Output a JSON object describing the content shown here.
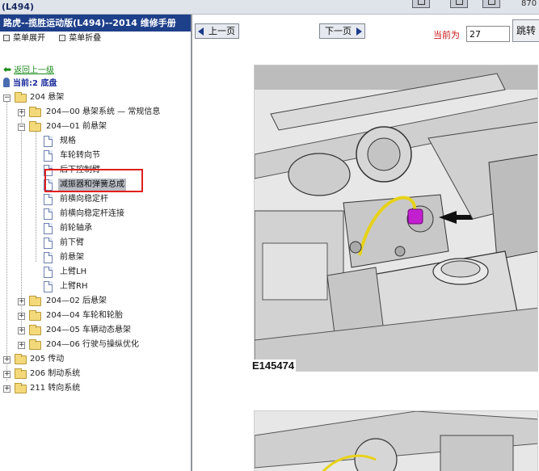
{
  "window": {
    "title": "(L494)",
    "corner_text": "870"
  },
  "sidebar": {
    "doc_title": "路虎--揽胜运动版(L494)--2014 维修手册",
    "menu_expand": "菜单展开",
    "menu_collapse": "菜单折叠",
    "back_link": "返回上一级",
    "current": "当前:2 底盘",
    "tree": {
      "n204": "204 悬架",
      "n204_00": "204—00 悬架系统 — 常规信息",
      "n204_01": "204—01 前悬架",
      "leaf_1": "规格",
      "leaf_2": "车轮转向节",
      "leaf_3": "后下控制臂",
      "leaf_4": "减振器和弹簧总成",
      "leaf_5": "前横向稳定杆",
      "leaf_6": "前横向稳定杆连接",
      "leaf_7": "前轮轴承",
      "leaf_8": "前下臂",
      "leaf_9": "前悬架",
      "leaf_10": "上臂LH",
      "leaf_11": "上臂RH",
      "n204_02": "204—02 后悬架",
      "n204_04": "204—04 车轮和轮胎",
      "n204_05": "204—05 车辆动态悬架",
      "n204_06": "204—06 行驶与操纵优化",
      "n205": "205 传动",
      "n206": "206 制动系统",
      "n211": "211 转向系统"
    }
  },
  "main": {
    "prev_label": "上一页",
    "next_label": "下一页",
    "current_label": "当前为",
    "page_value": "27",
    "jump_label": "跳转",
    "figure_caption": "E145474"
  },
  "colors": {
    "title_bar": "#1e3f8a",
    "highlight_box": "#e0201c",
    "current_label": "#c81818",
    "back_link": "#1a8a1a",
    "marker": "#c21fd0"
  }
}
